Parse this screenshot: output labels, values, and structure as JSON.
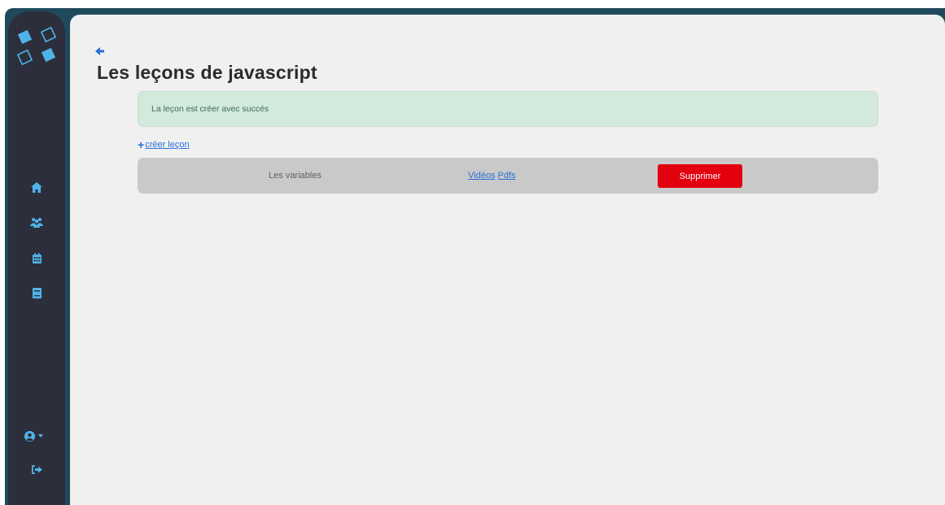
{
  "page": {
    "title": "Les leçons de javascript"
  },
  "alert": {
    "message": "La leçon est créer avec succés"
  },
  "actions": {
    "create_label": "créer leçon"
  },
  "lessons": [
    {
      "name": "Les variables",
      "videos_label": "Vidéos",
      "pdfs_label": "Pdfs",
      "delete_label": "Supprimer"
    }
  ],
  "icons": {
    "logo": "logo-squares-icon",
    "back": "arrow-left-icon",
    "home": "home-icon",
    "users": "users-icon",
    "calendar": "calendar-icon",
    "book": "book-icon",
    "user": "user-circle-icon",
    "dropdown": "caret-down-icon",
    "logout": "sign-out-icon"
  },
  "colors": {
    "sidebar_bg": "#2c2f3b",
    "accent": "#4fb3e8",
    "link": "#2a6fd6",
    "alert_bg": "#d3e9dc",
    "row_bg": "#c9c9c9",
    "danger": "#e3000f"
  }
}
